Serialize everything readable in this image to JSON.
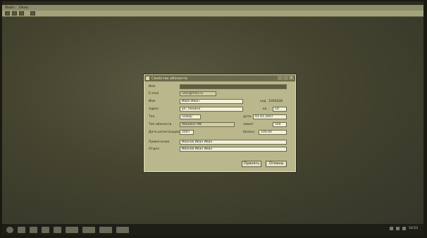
{
  "window": {
    "menu": [
      "Файл",
      "Окно"
    ]
  },
  "dialog": {
    "title": "Свойства абонента",
    "close_glyph": "×",
    "fields": [
      {
        "label": "Имя",
        "value": ""
      },
      {
        "label": "E-mail",
        "value": "user@mail.ru"
      },
      {
        "label": "Имя",
        "value": "Иван Иван"
      },
      {
        "label": "Адрес",
        "value": "ул. Ленина"
      },
      {
        "label": "Тел.",
        "value": "номер"
      },
      {
        "label": "Тип абонента",
        "value": "Абонент РФ"
      },
      {
        "label": "Дата регистрации",
        "value": "2007"
      },
      {
        "label": "Примечание",
        "value": "Иванов Иван Иван"
      },
      {
        "label": "Отдел",
        "value": "Иванов Иван Иван"
      }
    ],
    "side": {
      "code_label": "код",
      "code_value": "1000428",
      "num_label": "кв",
      "num_value": "10",
      "date_label": "дата",
      "date_value": "01.01.2007",
      "limit_label": "лимит",
      "limit_value": "500",
      "balance_label": "баланс",
      "balance_value": "100.00"
    },
    "buttons": {
      "ok": "Принять",
      "cancel": "Отмена"
    }
  },
  "taskbar": {
    "clock": "10:53"
  }
}
